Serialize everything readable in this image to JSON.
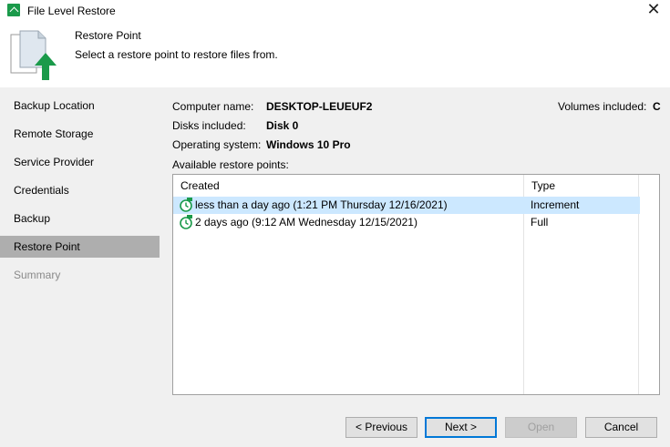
{
  "window": {
    "title": "File Level Restore"
  },
  "header": {
    "title": "Restore Point",
    "subtitle": "Select a restore point to restore files from."
  },
  "sidebar": {
    "items": [
      {
        "label": "Backup Location",
        "state": "normal"
      },
      {
        "label": "Remote Storage",
        "state": "normal"
      },
      {
        "label": "Service Provider",
        "state": "normal"
      },
      {
        "label": "Credentials",
        "state": "normal"
      },
      {
        "label": "Backup",
        "state": "normal"
      },
      {
        "label": "Restore Point",
        "state": "active"
      },
      {
        "label": "Summary",
        "state": "disabled"
      }
    ]
  },
  "details": {
    "computer_name_label": "Computer name:",
    "computer_name": "DESKTOP-LEUEUF2",
    "disks_label": "Disks included:",
    "disks": "Disk 0",
    "os_label": "Operating system:",
    "os": "Windows 10 Pro",
    "volumes_label": "Volumes included:",
    "volumes": "C",
    "restore_points_label": "Available restore points:"
  },
  "restore_points": {
    "columns": [
      "Created",
      "Type"
    ],
    "rows": [
      {
        "created": "less than a day ago (1:21 PM Thursday 12/16/2021)",
        "type": "Increment",
        "selected": true
      },
      {
        "created": "2 days ago (9:12 AM Wednesday 12/15/2021)",
        "type": "Full",
        "selected": false
      }
    ]
  },
  "buttons": {
    "previous": "< Previous",
    "next": "Next >",
    "open": "Open",
    "cancel": "Cancel"
  },
  "colors": {
    "accent_green": "#1a9a4a",
    "selection": "#cce8ff",
    "active_nav": "#aeaeae"
  }
}
